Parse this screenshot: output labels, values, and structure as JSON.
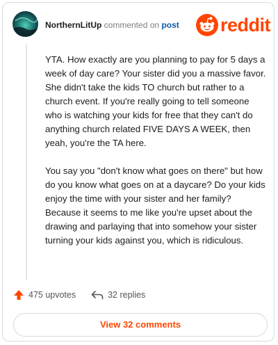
{
  "header": {
    "username": "NorthernLitUp",
    "action_text": "commented on",
    "post_link": "post",
    "logo_text": "reddit"
  },
  "comment": {
    "paragraphs": [
      "YTA. How exactly are you planning to pay for 5 days a week of day care? Your sister did you a massive favor. She didn't take the kids TO church but rather to a church event. If you're really going to tell someone who is watching your kids for free that they can't do anything church related FIVE DAYS A WEEK, then yeah, you're the TA here.",
      "You say you \"don't know what goes on there\" but how do you know what goes on at a daycare? Do your kids enjoy the time with your sister and her family? Because it seems to me like you're upset about the drawing and parlaying that into somehow your sister turning your kids against you, which is ridiculous."
    ]
  },
  "actions": {
    "upvotes": "475 upvotes",
    "replies": "32 replies"
  },
  "view_button": "View 32 comments",
  "icons": [
    "avatar",
    "reddit-logo-icon",
    "upvote-arrow-icon",
    "reply-icon"
  ],
  "colors": {
    "brand": "#ff4500",
    "link": "#0b5ba8"
  }
}
